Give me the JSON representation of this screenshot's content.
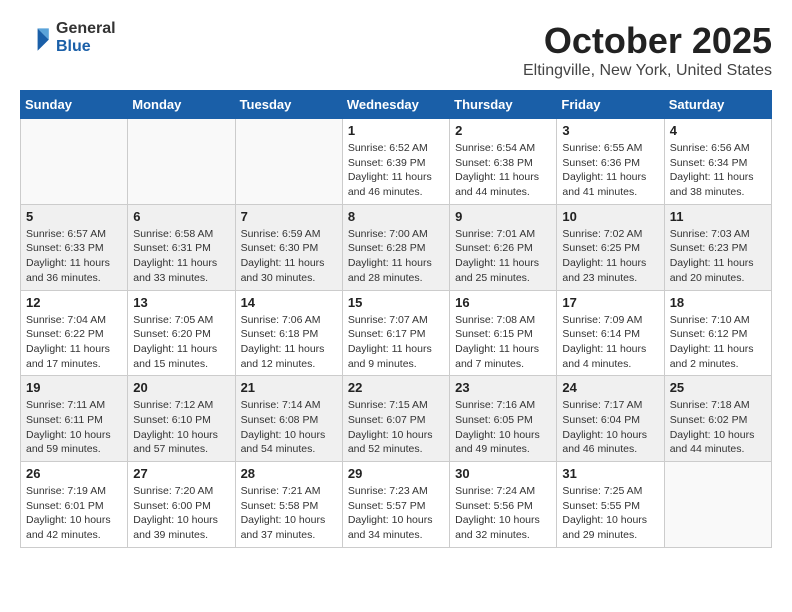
{
  "logo": {
    "general": "General",
    "blue": "Blue"
  },
  "title": "October 2025",
  "location": "Eltingville, New York, United States",
  "days_of_week": [
    "Sunday",
    "Monday",
    "Tuesday",
    "Wednesday",
    "Thursday",
    "Friday",
    "Saturday"
  ],
  "weeks": [
    [
      {
        "day": "",
        "info": ""
      },
      {
        "day": "",
        "info": ""
      },
      {
        "day": "",
        "info": ""
      },
      {
        "day": "1",
        "info": "Sunrise: 6:52 AM\nSunset: 6:39 PM\nDaylight: 11 hours\nand 46 minutes."
      },
      {
        "day": "2",
        "info": "Sunrise: 6:54 AM\nSunset: 6:38 PM\nDaylight: 11 hours\nand 44 minutes."
      },
      {
        "day": "3",
        "info": "Sunrise: 6:55 AM\nSunset: 6:36 PM\nDaylight: 11 hours\nand 41 minutes."
      },
      {
        "day": "4",
        "info": "Sunrise: 6:56 AM\nSunset: 6:34 PM\nDaylight: 11 hours\nand 38 minutes."
      }
    ],
    [
      {
        "day": "5",
        "info": "Sunrise: 6:57 AM\nSunset: 6:33 PM\nDaylight: 11 hours\nand 36 minutes."
      },
      {
        "day": "6",
        "info": "Sunrise: 6:58 AM\nSunset: 6:31 PM\nDaylight: 11 hours\nand 33 minutes."
      },
      {
        "day": "7",
        "info": "Sunrise: 6:59 AM\nSunset: 6:30 PM\nDaylight: 11 hours\nand 30 minutes."
      },
      {
        "day": "8",
        "info": "Sunrise: 7:00 AM\nSunset: 6:28 PM\nDaylight: 11 hours\nand 28 minutes."
      },
      {
        "day": "9",
        "info": "Sunrise: 7:01 AM\nSunset: 6:26 PM\nDaylight: 11 hours\nand 25 minutes."
      },
      {
        "day": "10",
        "info": "Sunrise: 7:02 AM\nSunset: 6:25 PM\nDaylight: 11 hours\nand 23 minutes."
      },
      {
        "day": "11",
        "info": "Sunrise: 7:03 AM\nSunset: 6:23 PM\nDaylight: 11 hours\nand 20 minutes."
      }
    ],
    [
      {
        "day": "12",
        "info": "Sunrise: 7:04 AM\nSunset: 6:22 PM\nDaylight: 11 hours\nand 17 minutes."
      },
      {
        "day": "13",
        "info": "Sunrise: 7:05 AM\nSunset: 6:20 PM\nDaylight: 11 hours\nand 15 minutes."
      },
      {
        "day": "14",
        "info": "Sunrise: 7:06 AM\nSunset: 6:18 PM\nDaylight: 11 hours\nand 12 minutes."
      },
      {
        "day": "15",
        "info": "Sunrise: 7:07 AM\nSunset: 6:17 PM\nDaylight: 11 hours\nand 9 minutes."
      },
      {
        "day": "16",
        "info": "Sunrise: 7:08 AM\nSunset: 6:15 PM\nDaylight: 11 hours\nand 7 minutes."
      },
      {
        "day": "17",
        "info": "Sunrise: 7:09 AM\nSunset: 6:14 PM\nDaylight: 11 hours\nand 4 minutes."
      },
      {
        "day": "18",
        "info": "Sunrise: 7:10 AM\nSunset: 6:12 PM\nDaylight: 11 hours\nand 2 minutes."
      }
    ],
    [
      {
        "day": "19",
        "info": "Sunrise: 7:11 AM\nSunset: 6:11 PM\nDaylight: 10 hours\nand 59 minutes."
      },
      {
        "day": "20",
        "info": "Sunrise: 7:12 AM\nSunset: 6:10 PM\nDaylight: 10 hours\nand 57 minutes."
      },
      {
        "day": "21",
        "info": "Sunrise: 7:14 AM\nSunset: 6:08 PM\nDaylight: 10 hours\nand 54 minutes."
      },
      {
        "day": "22",
        "info": "Sunrise: 7:15 AM\nSunset: 6:07 PM\nDaylight: 10 hours\nand 52 minutes."
      },
      {
        "day": "23",
        "info": "Sunrise: 7:16 AM\nSunset: 6:05 PM\nDaylight: 10 hours\nand 49 minutes."
      },
      {
        "day": "24",
        "info": "Sunrise: 7:17 AM\nSunset: 6:04 PM\nDaylight: 10 hours\nand 46 minutes."
      },
      {
        "day": "25",
        "info": "Sunrise: 7:18 AM\nSunset: 6:02 PM\nDaylight: 10 hours\nand 44 minutes."
      }
    ],
    [
      {
        "day": "26",
        "info": "Sunrise: 7:19 AM\nSunset: 6:01 PM\nDaylight: 10 hours\nand 42 minutes."
      },
      {
        "day": "27",
        "info": "Sunrise: 7:20 AM\nSunset: 6:00 PM\nDaylight: 10 hours\nand 39 minutes."
      },
      {
        "day": "28",
        "info": "Sunrise: 7:21 AM\nSunset: 5:58 PM\nDaylight: 10 hours\nand 37 minutes."
      },
      {
        "day": "29",
        "info": "Sunrise: 7:23 AM\nSunset: 5:57 PM\nDaylight: 10 hours\nand 34 minutes."
      },
      {
        "day": "30",
        "info": "Sunrise: 7:24 AM\nSunset: 5:56 PM\nDaylight: 10 hours\nand 32 minutes."
      },
      {
        "day": "31",
        "info": "Sunrise: 7:25 AM\nSunset: 5:55 PM\nDaylight: 10 hours\nand 29 minutes."
      },
      {
        "day": "",
        "info": ""
      }
    ]
  ]
}
